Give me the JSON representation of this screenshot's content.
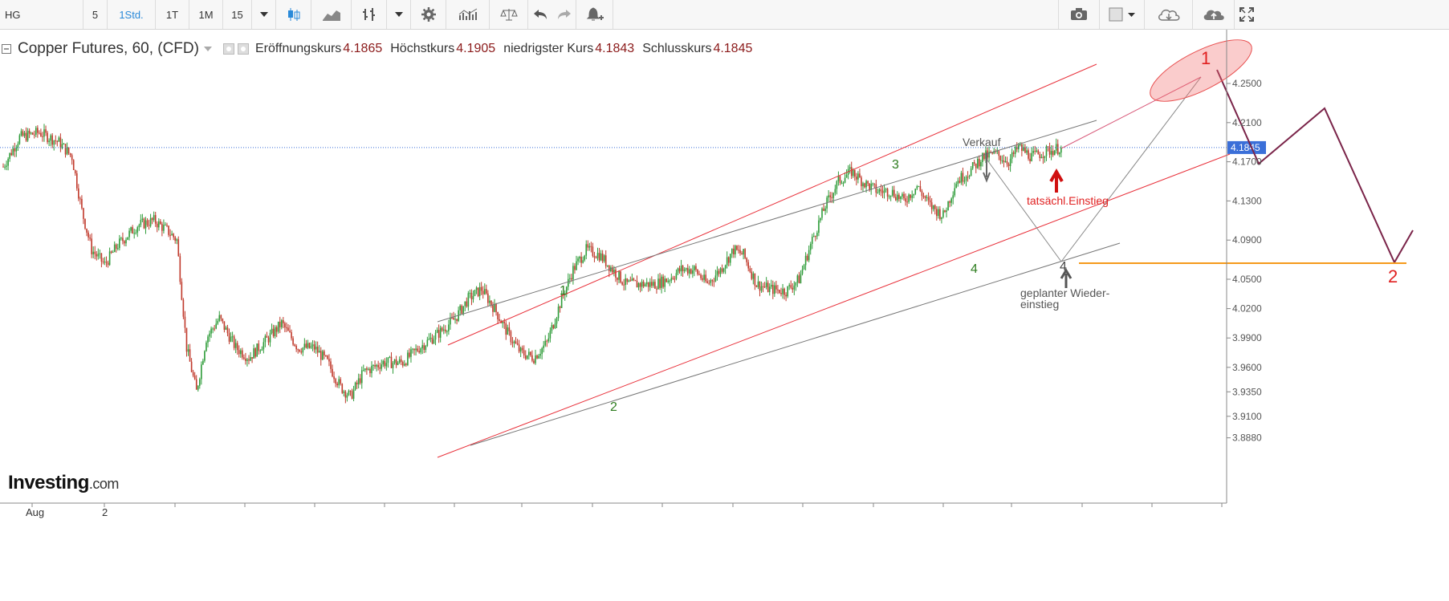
{
  "toolbar": {
    "symbol": "HG",
    "intervals": [
      "5",
      "1Std.",
      "1T",
      "1M",
      "15"
    ],
    "active_interval": "1Std."
  },
  "legend": {
    "symbol_title": "Copper Futures, 60, (CFD)",
    "open_label": "Eröffnungskurs",
    "open_value": "4.1865",
    "high_label": "Höchstkurs",
    "high_value": "4.1905",
    "low_label": "niedrigster Kurs",
    "low_value": "4.1843",
    "close_label": "Schlusskurs",
    "close_value": "4.1845"
  },
  "colors": {
    "up": "#2f9c3a",
    "down": "#c0392b",
    "channel_red": "#e8303a",
    "channel_gray": "#777777",
    "projection": "#7a2449",
    "target": "#f59a1b",
    "price_line": "#3b6fd8",
    "wave_label": "#2e7d1f"
  },
  "chart_data": {
    "type": "candlestick",
    "title": "Copper Futures, 60, (CFD)",
    "ylim": [
      3.88,
      4.31
    ],
    "y_ticks": [
      "4.2500",
      "4.2100",
      "4.1700",
      "4.1300",
      "4.0900",
      "4.0500",
      "4.0200",
      "3.9900",
      "3.9600",
      "3.9350",
      "3.9100",
      "3.8880"
    ],
    "x_ticks": [
      "Aug",
      "2"
    ],
    "last_price": "4.1845",
    "series": [
      {
        "name": "HG",
        "anchors": [
          [
            0,
            4.165
          ],
          [
            10,
            4.195
          ],
          [
            22,
            4.2
          ],
          [
            34,
            4.19
          ],
          [
            42,
            4.175
          ],
          [
            48,
            4.12
          ],
          [
            54,
            4.08
          ],
          [
            62,
            4.065
          ],
          [
            70,
            4.085
          ],
          [
            82,
            4.105
          ],
          [
            92,
            4.11
          ],
          [
            100,
            4.1
          ],
          [
            106,
            4.09
          ],
          [
            112,
            3.98
          ],
          [
            118,
            3.935
          ],
          [
            124,
            3.99
          ],
          [
            132,
            4.01
          ],
          [
            142,
            3.98
          ],
          [
            150,
            3.97
          ],
          [
            162,
            3.99
          ],
          [
            170,
            4.005
          ],
          [
            180,
            3.98
          ],
          [
            190,
            3.98
          ],
          [
            198,
            3.965
          ],
          [
            206,
            3.94
          ],
          [
            212,
            3.93
          ],
          [
            220,
            3.955
          ],
          [
            232,
            3.965
          ],
          [
            244,
            3.965
          ],
          [
            254,
            3.98
          ],
          [
            266,
            3.995
          ],
          [
            276,
            4.01
          ],
          [
            284,
            4.03
          ],
          [
            292,
            4.04
          ],
          [
            300,
            4.02
          ],
          [
            308,
            3.995
          ],
          [
            316,
            3.975
          ],
          [
            324,
            3.97
          ],
          [
            332,
            3.985
          ],
          [
            340,
            4.025
          ],
          [
            348,
            4.06
          ],
          [
            356,
            4.08
          ],
          [
            364,
            4.075
          ],
          [
            372,
            4.06
          ],
          [
            380,
            4.045
          ],
          [
            390,
            4.045
          ],
          [
            398,
            4.045
          ],
          [
            406,
            4.05
          ],
          [
            414,
            4.06
          ],
          [
            422,
            4.06
          ],
          [
            430,
            4.045
          ],
          [
            438,
            4.06
          ],
          [
            446,
            4.08
          ],
          [
            452,
            4.075
          ],
          [
            460,
            4.045
          ],
          [
            468,
            4.04
          ],
          [
            478,
            4.038
          ],
          [
            486,
            4.05
          ],
          [
            494,
            4.09
          ],
          [
            502,
            4.125
          ],
          [
            510,
            4.15
          ],
          [
            518,
            4.16
          ],
          [
            526,
            4.148
          ],
          [
            534,
            4.14
          ],
          [
            542,
            4.14
          ],
          [
            550,
            4.13
          ],
          [
            558,
            4.145
          ],
          [
            566,
            4.125
          ],
          [
            574,
            4.115
          ],
          [
            582,
            4.15
          ],
          [
            590,
            4.16
          ],
          [
            598,
            4.175
          ],
          [
            606,
            4.178
          ],
          [
            614,
            4.17
          ],
          [
            620,
            4.185
          ],
          [
            628,
            4.175
          ],
          [
            636,
            4.18
          ],
          [
            646,
            4.1845
          ]
        ]
      }
    ]
  },
  "annotations": {
    "wave_1_ch": "1",
    "wave_2_ch": "2",
    "wave_3_ch": "3",
    "wave_4_ch": "4",
    "wave_4_planned": "4",
    "proj_1": "1",
    "proj_2": "2",
    "sell": "Verkauf",
    "actual_entry": "tatsächl.Einstieg",
    "planned_line1": "geplanter Wieder-",
    "planned_line2": "einstieg"
  },
  "watermark": "Investing",
  "watermark_suffix": ".com"
}
